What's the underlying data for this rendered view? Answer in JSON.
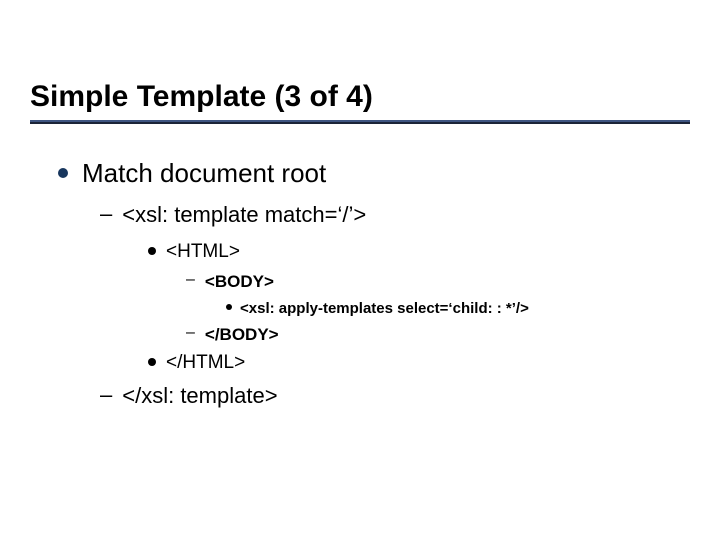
{
  "title": "Simple Template (3 of 4)",
  "bullets": {
    "l1": "Match document root",
    "l2_open": "<xsl: template match=‘/’>",
    "l3_open": "<HTML>",
    "l4_open": "<BODY>",
    "l5": "<xsl: apply-templates select=‘child: : *’/>",
    "l4_close": "</BODY>",
    "l3_close": "</HTML>",
    "l2_close": "</xsl: template>"
  }
}
